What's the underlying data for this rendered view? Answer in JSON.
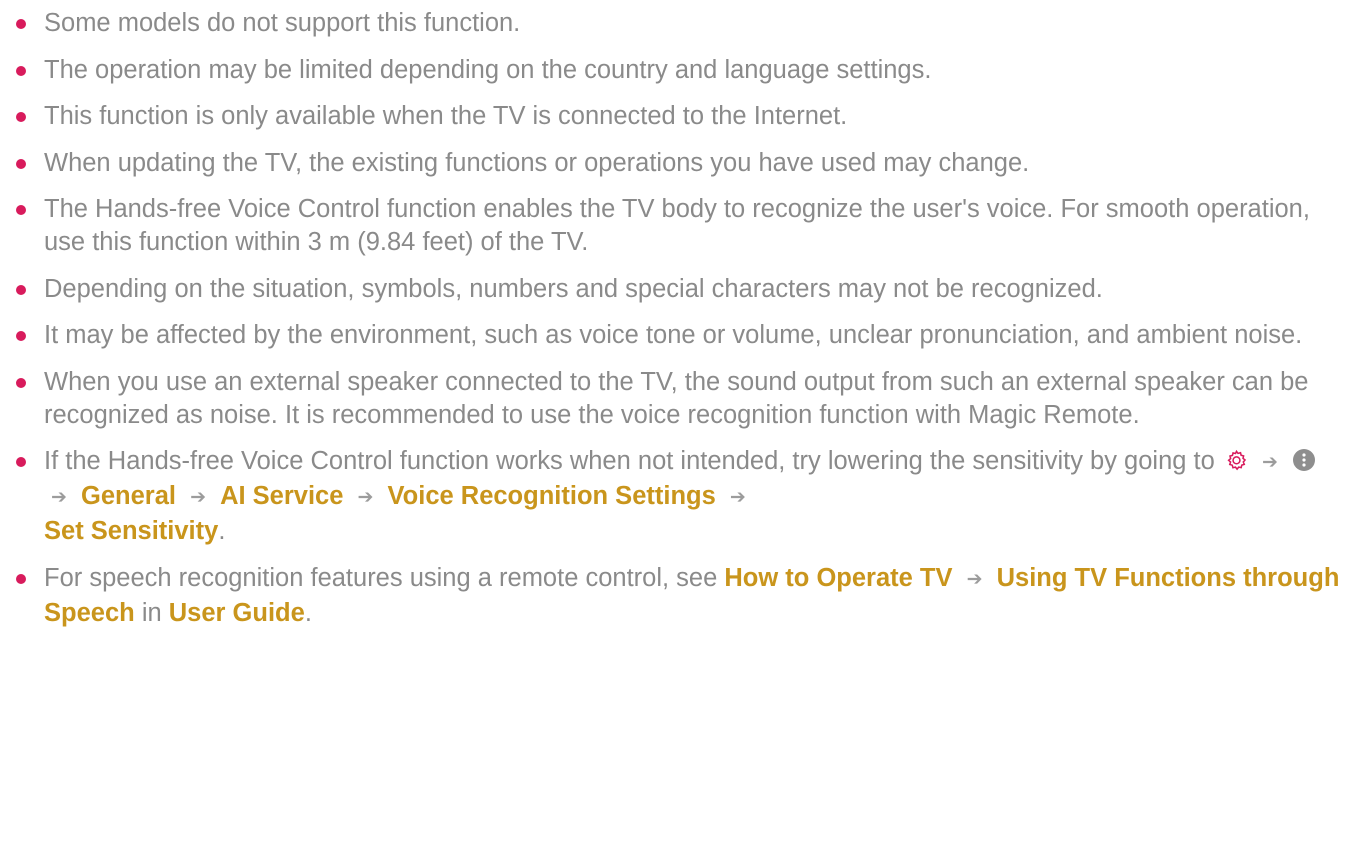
{
  "colors": {
    "bullet": "#d81b5c",
    "body_text": "#8a8a8a",
    "menu_reference": "#c9951c",
    "arrow": "#9c9c9c"
  },
  "notes": {
    "n1": "Some models do not support this function.",
    "n2": "The operation may be limited depending on the country and language settings.",
    "n3": "This function is only available when the TV is connected to the Internet.",
    "n4": "When updating the TV, the existing functions or operations you have used may change.",
    "n5": "The Hands-free Voice Control function enables the TV body to recognize the user's voice. For smooth operation, use this function within 3 m (9.84 feet) of the TV.",
    "n6": "Depending on the situation, symbols, numbers and special characters may not be recognized.",
    "n7": "It may be affected by the environment, such as voice tone or volume, unclear pronunciation, and ambient noise.",
    "n8": "When you use an external speaker connected to the TV, the sound output from such an external speaker can be recognized as noise. It is recommended to use the voice recognition function with Magic Remote.",
    "n9": {
      "text": "If the Hands-free Voice Control function works when not intended, try lowering the sensitivity by going to",
      "icons": [
        "gear-icon",
        "more-dots-icon"
      ],
      "path": [
        "General",
        "AI Service",
        "Voice Recognition Settings",
        "Set Sensitivity"
      ],
      "end": "."
    },
    "n10": {
      "text": "For speech recognition features using a remote control, see",
      "path": [
        "How to Operate TV",
        "Using TV Functions through Speech"
      ],
      "connector": "in",
      "guide": "User Guide",
      "end": "."
    }
  },
  "symbols": {
    "arrow": "➔"
  }
}
